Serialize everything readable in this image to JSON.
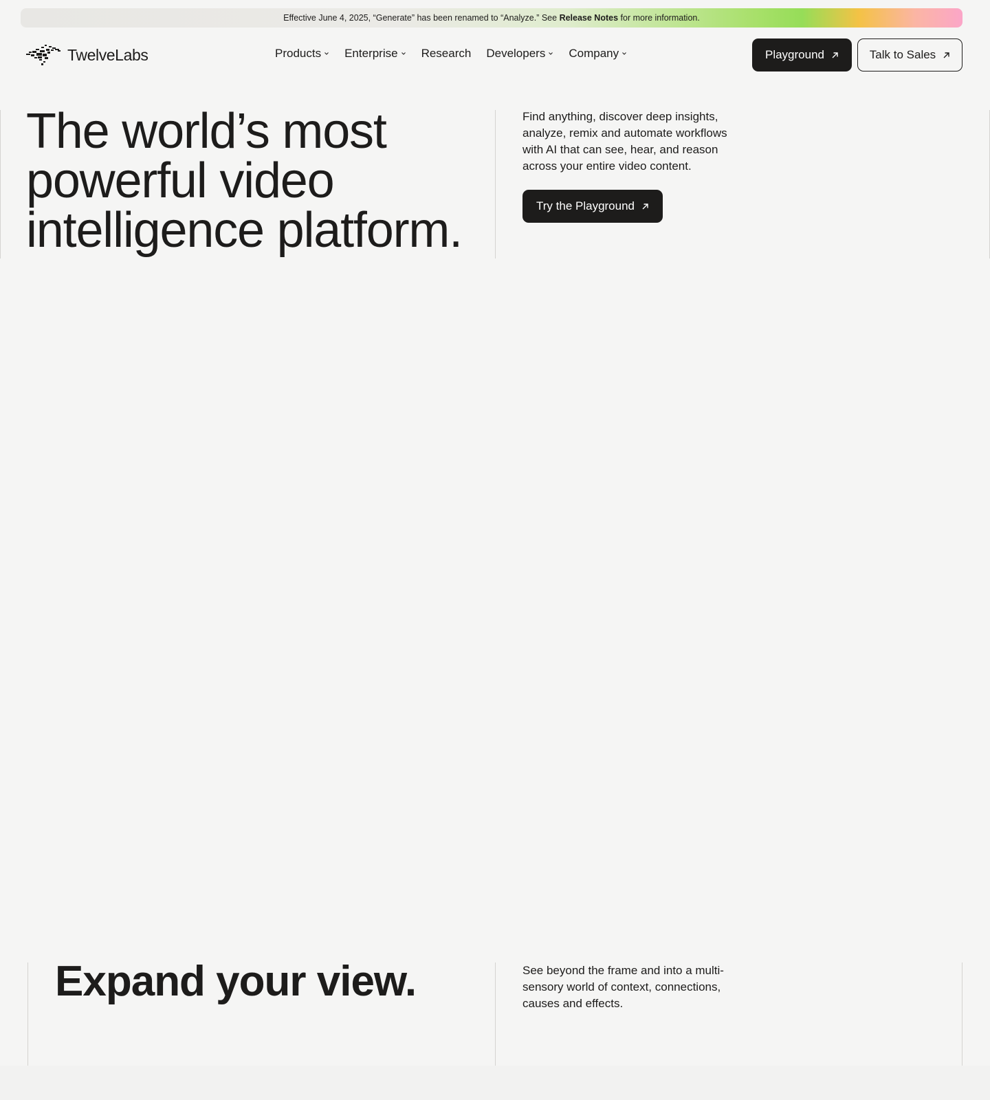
{
  "banner": {
    "text_before": "Effective June 4, 2025, “Generate” has been renamed to “Analyze.” See",
    "link": "Release Notes",
    "text_after": "for more information."
  },
  "header": {
    "logo_text": "TwelveLabs",
    "nav": [
      {
        "label": "Products",
        "has_dropdown": true
      },
      {
        "label": "Enterprise",
        "has_dropdown": true
      },
      {
        "label": "Research",
        "has_dropdown": false
      },
      {
        "label": "Developers",
        "has_dropdown": true
      },
      {
        "label": "Company",
        "has_dropdown": true
      }
    ],
    "playground_label": "Playground",
    "sales_label": "Talk to Sales"
  },
  "hero": {
    "title_lines": [
      "The world’s most",
      "powerful video",
      "intelligence platform."
    ],
    "description": "Find anything, discover deep insights, analyze, remix and automate workflows with AI that can see, hear, and reason across your entire video content.",
    "cta_label": "Try the Playground"
  },
  "expand": {
    "title": "Expand your view.",
    "description": "See beyond the frame and into a multi-sensory world of context, connections, causes and effects."
  },
  "icons": {
    "arrow": "arrow-up-right-icon",
    "chevron": "chevron-down-icon",
    "logo": "twelvelabs-logo-icon"
  },
  "colors": {
    "background": "#f5f5f4",
    "text": "#1d1c1b",
    "button_dark": "#1d1c1b",
    "banner_gradient_green": "#96dd58",
    "banner_gradient_yellow": "#f4c245",
    "banner_gradient_pink": "#fba6c8"
  }
}
